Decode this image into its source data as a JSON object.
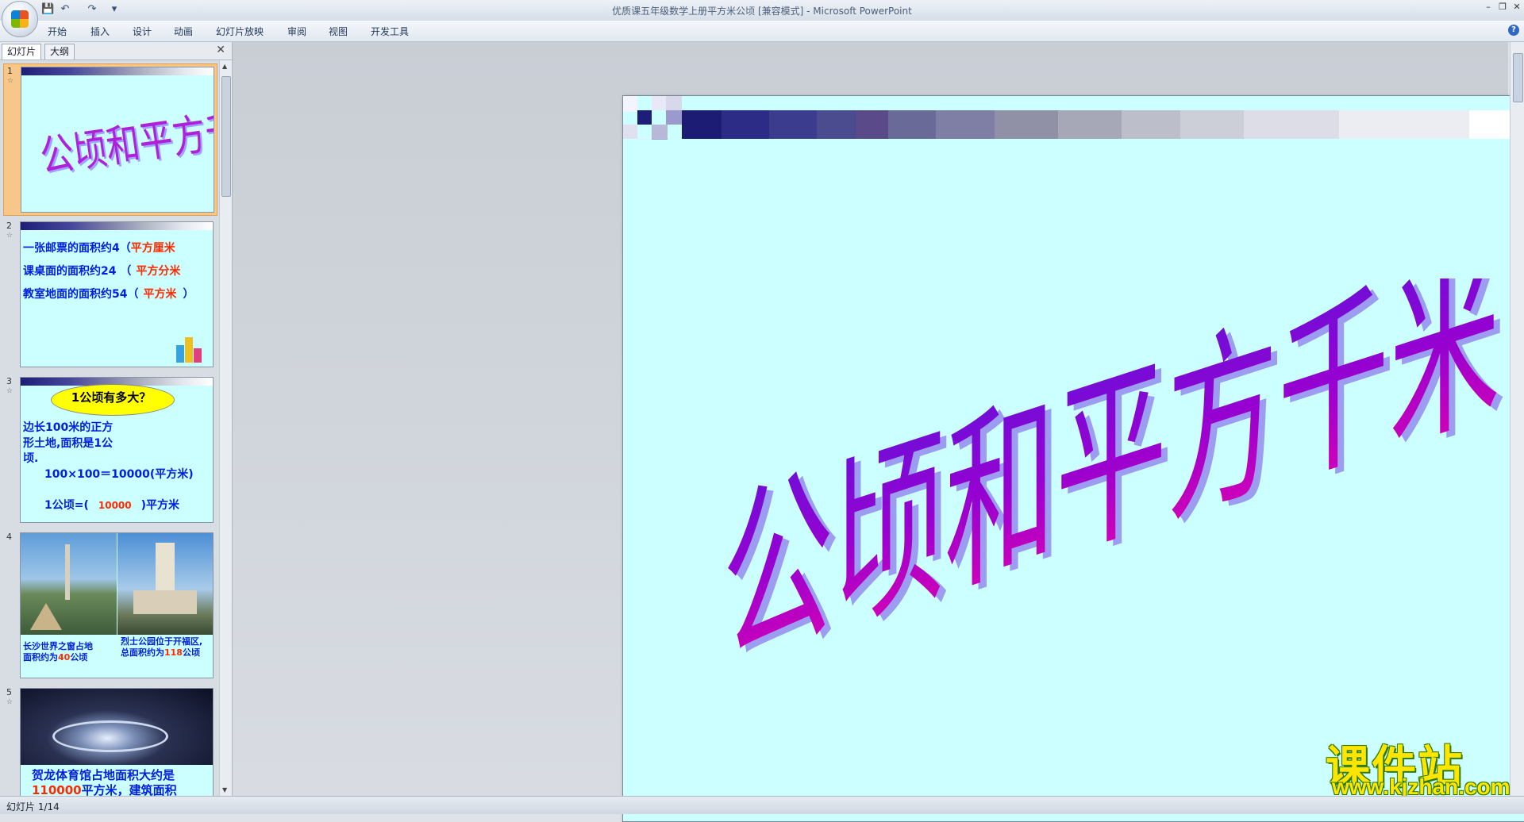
{
  "window": {
    "title": "优质课五年级数学上册平方米公顷 [兼容模式] - Microsoft PowerPoint",
    "minimize": "–",
    "restore": "❐",
    "close": "✕"
  },
  "quick_access": {
    "save": "💾",
    "undo": "↶",
    "redo": "↷",
    "more": "▾"
  },
  "ribbon": {
    "tabs": [
      "开始",
      "插入",
      "设计",
      "动画",
      "幻灯片放映",
      "审阅",
      "视图",
      "开发工具"
    ],
    "help": "?"
  },
  "left_pane": {
    "tabs": [
      "幻灯片",
      "大纲"
    ],
    "close": "✕",
    "slides": [
      {
        "number": "1",
        "title": "公顷和平方千米"
      },
      {
        "number": "2",
        "lines": [
          {
            "text": "一张邮票的面积约4（",
            "answer": "平方厘米"
          },
          {
            "text": "课桌面的面积约24 （",
            "answer": "平方分米"
          },
          {
            "text": "教室地面的面积约54（",
            "answer": "平方米",
            "end": "）"
          }
        ]
      },
      {
        "number": "3",
        "bubble": "1公顷有多大？",
        "lines": [
          "边长100米的正方",
          "形土地,面积是1公",
          "顷."
        ],
        "formula": "100×100＝10000(平方米)",
        "fill_prefix": "1公顷=(",
        "fill_answer": "10000",
        "fill_suffix": ")平方米"
      },
      {
        "number": "4",
        "caption_left": [
          "长沙世界之窗占地",
          "面积约为",
          "40",
          "公顷"
        ],
        "caption_right": [
          "烈士公园位于开福区,",
          "总面积约为",
          "118",
          "公顷"
        ]
      },
      {
        "number": "5",
        "caption": "贺龙体育馆占地面积大约是",
        "caption2_red": "110000",
        "caption2": "平方米，建筑面积"
      }
    ]
  },
  "slide": {
    "title": "公顷和平方千米"
  },
  "watermark": {
    "brand": "课件站",
    "url": "www.kjzhan.com"
  },
  "status_bar": {
    "text": "幻灯片 1/14"
  },
  "colors": {
    "title_purple": "#9900cc",
    "title_magenta": "#e000b0",
    "slide_bg": "#ccffff",
    "text_blue": "#0020e0",
    "text_red": "#ff2a00"
  }
}
